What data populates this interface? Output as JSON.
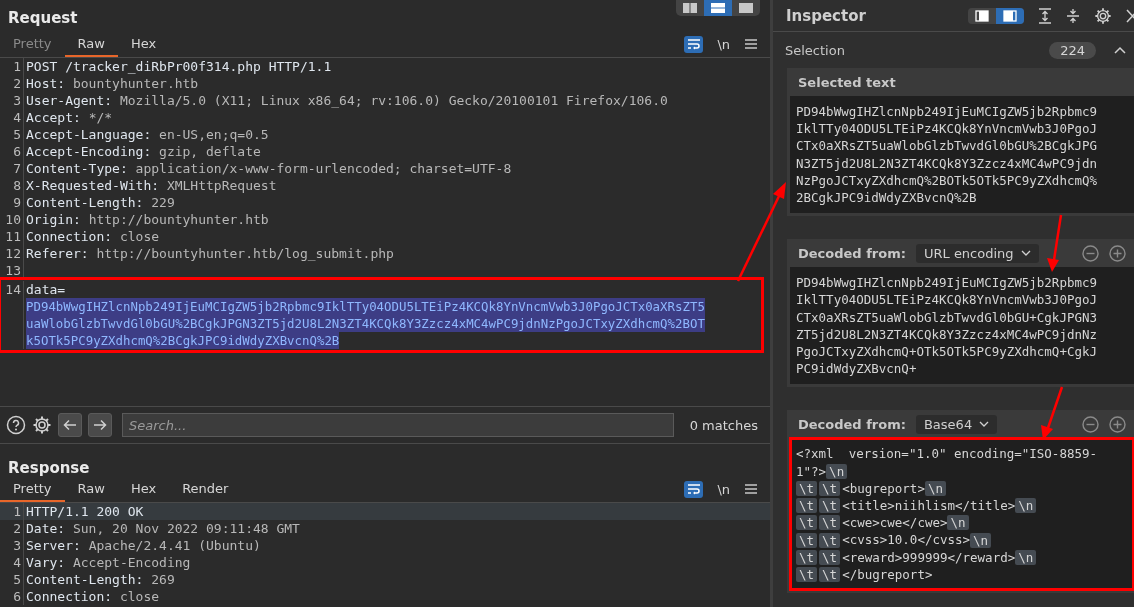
{
  "request": {
    "title": "Request",
    "layout_buttons": [
      {
        "selected": false
      },
      {
        "selected": true
      },
      {
        "selected": false
      }
    ],
    "tabs": [
      {
        "label": "Pretty",
        "selected": false,
        "disabled": true
      },
      {
        "label": "Raw",
        "selected": true,
        "disabled": false
      },
      {
        "label": "Hex",
        "selected": false,
        "disabled": false
      }
    ],
    "wrap_on": true,
    "newline_label": "\\n",
    "lines": [
      {
        "num": "1",
        "text": "POST /tracker_diRbPr00f314.php HTTP/1.1"
      },
      {
        "num": "2",
        "key": "Host:",
        "value": "bountyhunter.htb"
      },
      {
        "num": "3",
        "key": "User-Agent:",
        "value": "Mozilla/5.0 (X11; Linux x86_64; rv:106.0) Gecko/20100101 Firefox/106.0"
      },
      {
        "num": "4",
        "key": "Accept:",
        "value": "*/*"
      },
      {
        "num": "5",
        "key": "Accept-Language:",
        "value": "en-US,en;q=0.5"
      },
      {
        "num": "6",
        "key": "Accept-Encoding:",
        "value": "gzip, deflate"
      },
      {
        "num": "7",
        "key": "Content-Type:",
        "value": "application/x-www-form-urlencoded; charset=UTF-8"
      },
      {
        "num": "8",
        "key": "X-Requested-With:",
        "value": "XMLHttpRequest"
      },
      {
        "num": "9",
        "key": "Content-Length:",
        "value": "229"
      },
      {
        "num": "10",
        "key": "Origin:",
        "value": "http://bountyhunter.htb"
      },
      {
        "num": "11",
        "key": "Connection:",
        "value": "close"
      },
      {
        "num": "12",
        "key": "Referer:",
        "value": "http://bountyhunter.htb/log_submit.php"
      },
      {
        "num": "13"
      },
      {
        "num": "14",
        "key": "data=",
        "boxed": true,
        "selected_lines": [
          "PD94bWwgIHZlcnNpb249IjEuMCIgZW5jb2Rpbmc9IklTTy04ODU5LTEiPz4KCQk8YnVncmVwb3J0PgoJCTx0aXRsZT5",
          "uaWlobGlzbTwvdGl0bGU%2BCgkJPGN3ZT5jd2U8L2N3ZT4KCQk8Y3Zzcz4xMC4wPC9jdnNzPgoJCTxyZXdhcmQ%2BOT",
          "k5OTk5PC9yZXdhcmQ%2BCgkJPC9idWdyZXBvcnQ%2B"
        ]
      }
    ]
  },
  "search": {
    "placeholder": "Search...",
    "matches": "0 matches"
  },
  "response": {
    "title": "Response",
    "tabs": [
      {
        "label": "Pretty",
        "selected": true,
        "disabled": false
      },
      {
        "label": "Raw",
        "selected": false,
        "disabled": false
      },
      {
        "label": "Hex",
        "selected": false,
        "disabled": false
      },
      {
        "label": "Render",
        "selected": false,
        "disabled": false
      }
    ],
    "wrap_on": true,
    "newline_label": "\\n",
    "lines": [
      {
        "num": "1",
        "text": "HTTP/1.1 200 OK",
        "current": true
      },
      {
        "num": "2",
        "key": "Date:",
        "value": "Sun, 20 Nov 2022 09:11:48 GMT",
        "current": false
      },
      {
        "num": "3",
        "key": "Server:",
        "value": "Apache/2.4.41 (Ubuntu)",
        "current": false
      },
      {
        "num": "4",
        "key": "Vary:",
        "value": "Accept-Encoding",
        "current": false
      },
      {
        "num": "5",
        "key": "Content-Length:",
        "value": "269",
        "current": false
      },
      {
        "num": "6",
        "key": "Connection:",
        "value": "close",
        "current": false
      }
    ]
  },
  "inspector": {
    "title": "Inspector",
    "layout_buttons": [
      {
        "selected": false
      },
      {
        "selected": true
      }
    ],
    "selection": {
      "label": "Selection",
      "count": "224",
      "expanded": true
    },
    "sections": [
      {
        "kind": "selected",
        "title": "Selected text",
        "boxed": false,
        "lines": [
          [
            {
              "kind": "text",
              "text": "PD94bWwgIHZlcnNpb249IjEuMCIgZW5jb2Rpbmc9"
            }
          ],
          [
            {
              "kind": "text",
              "text": "IklTTy04ODU5LTEiPz4KCQk8YnVncmVwb3J0PgoJ"
            }
          ],
          [
            {
              "kind": "text",
              "text": "CTx0aXRsZT5uaWlobGlzbTwvdGl0bGU%2BCgkJPG"
            }
          ],
          [
            {
              "kind": "text",
              "text": "N3ZT5jd2U8L2N3ZT4KCQk8Y3Zzcz4xMC4wPC9jdn"
            }
          ],
          [
            {
              "kind": "text",
              "text": "NzPgoJCTxyZXdhcmQ%2BOTk5OTk5PC9yZXdhcmQ%"
            }
          ],
          [
            {
              "kind": "text",
              "text": "2BCgkJPC9idWdyZXBvcnQ%2B"
            }
          ]
        ]
      },
      {
        "kind": "decoded",
        "title": "Decoded from:",
        "encoding": "URL encoding",
        "boxed": false,
        "lines": [
          [
            {
              "kind": "text",
              "text": "PD94bWwgIHZlcnNpb249IjEuMCIgZW5jb2Rpbmc9"
            }
          ],
          [
            {
              "kind": "text",
              "text": "IklTTy04ODU5LTEiPz4KCQk8YnVncmVwb3J0PgoJ"
            }
          ],
          [
            {
              "kind": "text",
              "text": "CTx0aXRsZT5uaWlobGlzbTwvdGl0bGU+CgkJPGN3"
            }
          ],
          [
            {
              "kind": "text",
              "text": "ZT5jd2U8L2N3ZT4KCQk8Y3Zzcz4xMC4wPC9jdnNz"
            }
          ],
          [
            {
              "kind": "text",
              "text": "PgoJCTxyZXdhcmQ+OTk5OTk5PC9yZXdhcmQ+CgkJ"
            }
          ],
          [
            {
              "kind": "text",
              "text": "PC9idWdyZXBvcnQ+"
            }
          ]
        ]
      },
      {
        "kind": "decoded",
        "title": "Decoded from:",
        "encoding": "Base64",
        "boxed": true,
        "lines": [
          [
            {
              "kind": "text",
              "text": "<?xml  version=\"1.0\" encoding=\"ISO-8859-"
            }
          ],
          [
            {
              "kind": "text",
              "text": "1\"?>"
            },
            {
              "kind": "escape",
              "text": "\\n"
            }
          ],
          [
            {
              "kind": "escape",
              "text": "\\t"
            },
            {
              "kind": "escape",
              "text": "\\t"
            },
            {
              "kind": "text",
              "text": "<bugreport>"
            },
            {
              "kind": "escape",
              "text": "\\n"
            }
          ],
          [
            {
              "kind": "escape",
              "text": "\\t"
            },
            {
              "kind": "escape",
              "text": "\\t"
            },
            {
              "kind": "text",
              "text": "<title>niihlism</title>"
            },
            {
              "kind": "escape",
              "text": "\\n"
            }
          ],
          [
            {
              "kind": "escape",
              "text": "\\t"
            },
            {
              "kind": "escape",
              "text": "\\t"
            },
            {
              "kind": "text",
              "text": "<cwe>cwe</cwe>"
            },
            {
              "kind": "escape",
              "text": "\\n"
            }
          ],
          [
            {
              "kind": "escape",
              "text": "\\t"
            },
            {
              "kind": "escape",
              "text": "\\t"
            },
            {
              "kind": "text",
              "text": "<cvss>10.0</cvss>"
            },
            {
              "kind": "escape",
              "text": "\\n"
            }
          ],
          [
            {
              "kind": "escape",
              "text": "\\t"
            },
            {
              "kind": "escape",
              "text": "\\t"
            },
            {
              "kind": "text",
              "text": "<reward>999999</reward>"
            },
            {
              "kind": "escape",
              "text": "\\n"
            }
          ],
          [
            {
              "kind": "escape",
              "text": "\\t"
            },
            {
              "kind": "escape",
              "text": "\\t"
            },
            {
              "kind": "text",
              "text": "</bugreport>"
            }
          ]
        ]
      }
    ]
  }
}
